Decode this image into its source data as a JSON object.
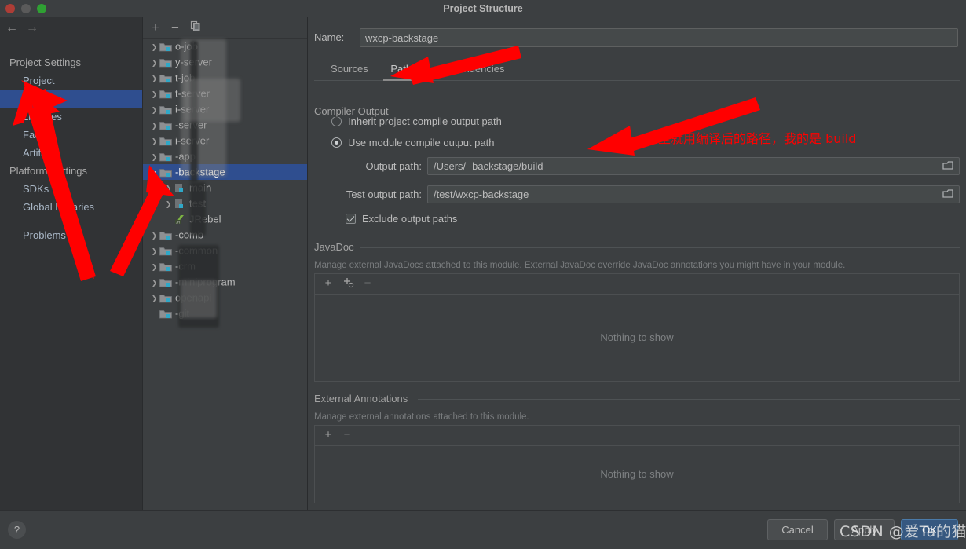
{
  "window": {
    "title": "Project Structure",
    "traffic_lights": [
      "close-red",
      "minimize-gray",
      "zoom-green"
    ]
  },
  "nav": {
    "back": "←",
    "forward": "→"
  },
  "sidebar": {
    "groups": [
      {
        "label": "Project Settings",
        "type": "group"
      },
      {
        "label": "Project",
        "type": "child",
        "selected": false
      },
      {
        "label": "Modules",
        "type": "child",
        "selected": true
      },
      {
        "label": "Libraries",
        "type": "child",
        "selected": false
      },
      {
        "label": "Facets",
        "type": "child",
        "selected": false
      },
      {
        "label": "Artifacts",
        "type": "child",
        "selected": false
      },
      {
        "label": "Platform Settings",
        "type": "group"
      },
      {
        "label": "SDKs",
        "type": "child",
        "selected": false
      },
      {
        "label": "Global Libraries",
        "type": "child",
        "selected": false
      },
      {
        "label": "Problems",
        "type": "child",
        "selected": false
      }
    ]
  },
  "tree_toolbar": {
    "add": "+",
    "remove": "−",
    "copy": "copy-icon"
  },
  "tree": {
    "items": [
      {
        "label": "o-job",
        "level": 1,
        "expandable": true,
        "expanded": false,
        "selected": false,
        "icon": "module-folder-icon"
      },
      {
        "label": "y-server",
        "level": 1,
        "expandable": true,
        "expanded": false,
        "selected": false,
        "icon": "module-folder-icon"
      },
      {
        "label": "t-job",
        "level": 1,
        "expandable": true,
        "expanded": false,
        "selected": false,
        "icon": "module-folder-icon"
      },
      {
        "label": "t-server",
        "level": 1,
        "expandable": true,
        "expanded": false,
        "selected": false,
        "icon": "module-folder-icon"
      },
      {
        "label": "i-server",
        "level": 1,
        "expandable": true,
        "expanded": false,
        "selected": false,
        "icon": "module-folder-icon"
      },
      {
        "label": "-server",
        "level": 1,
        "expandable": true,
        "expanded": false,
        "selected": false,
        "icon": "module-folder-icon"
      },
      {
        "label": "i-server",
        "level": 1,
        "expandable": true,
        "expanded": false,
        "selected": false,
        "icon": "module-folder-icon"
      },
      {
        "label": "-app",
        "level": 1,
        "expandable": true,
        "expanded": false,
        "selected": false,
        "icon": "module-folder-icon"
      },
      {
        "label": "-backstage",
        "level": 1,
        "expandable": true,
        "expanded": true,
        "selected": true,
        "icon": "module-folder-icon"
      },
      {
        "label": "main",
        "level": 2,
        "expandable": true,
        "expanded": false,
        "selected": false,
        "icon": "source-folder-icon"
      },
      {
        "label": "test",
        "level": 2,
        "expandable": true,
        "expanded": false,
        "selected": false,
        "icon": "source-folder-icon"
      },
      {
        "label": "JRebel",
        "level": 2,
        "expandable": false,
        "expanded": false,
        "selected": false,
        "icon": "jrebel-icon"
      },
      {
        "label": "-comb",
        "level": 1,
        "expandable": true,
        "expanded": false,
        "selected": false,
        "icon": "module-folder-icon"
      },
      {
        "label": "-common",
        "level": 1,
        "expandable": true,
        "expanded": false,
        "selected": false,
        "icon": "module-folder-icon"
      },
      {
        "label": "-crm",
        "level": 1,
        "expandable": true,
        "expanded": false,
        "selected": false,
        "icon": "module-folder-icon"
      },
      {
        "label": "-miniprogram",
        "level": 1,
        "expandable": true,
        "expanded": false,
        "selected": false,
        "icon": "module-folder-icon"
      },
      {
        "label": "openapi",
        "level": 1,
        "expandable": true,
        "expanded": false,
        "selected": false,
        "icon": "module-folder-icon"
      },
      {
        "label": "-git",
        "level": 1,
        "expandable": false,
        "expanded": false,
        "selected": false,
        "icon": "module-folder-icon"
      }
    ]
  },
  "module": {
    "name_label": "Name:",
    "name_value": "wxcp-backstage",
    "tabs": [
      {
        "label": "Sources",
        "active": false
      },
      {
        "label": "Paths",
        "active": true
      },
      {
        "label": "Dependencies",
        "active": false
      }
    ]
  },
  "compiler_output": {
    "section_title": "Compiler Output",
    "inherit_label": "Inherit project compile output path",
    "inherit_selected": false,
    "use_module_label": "Use module compile output path",
    "use_module_selected": true,
    "output_path_label": "Output path:",
    "output_path_value": "/Users/                                            -backstage/build",
    "test_output_path_label": "Test output path:",
    "test_output_path_value": "/test/wxcp-backstage",
    "exclude_label": "Exclude output paths",
    "exclude_checked": true,
    "browse_icon": "folder-browse-icon"
  },
  "javadoc": {
    "section_title": "JavaDoc",
    "description": "Manage external JavaDocs attached to this module. External JavaDoc override JavaDoc annotations you might have in your module.",
    "add": "+",
    "add_url": "+",
    "remove": "−",
    "empty_text": "Nothing to show"
  },
  "external_annotations": {
    "section_title": "External Annotations",
    "description": "Manage external annotations attached to this module.",
    "add": "+",
    "remove": "−",
    "empty_text": "Nothing to show"
  },
  "footer": {
    "help": "?",
    "cancel": "Cancel",
    "apply": "Apply",
    "ok": "OK"
  },
  "annotations": {
    "chinese_note": "这里就用编译后的路径，我的是 build",
    "watermark": "CSDN @爱Ta的猫",
    "arrow_color": "#ff0000"
  },
  "colors": {
    "accent": "#2f4e8f",
    "panel_bg": "#3c3f41",
    "sidebar_bg": "#313335",
    "text": "#bbbbbb",
    "annotation_red": "#ff0000",
    "primary_button": "#365880"
  }
}
